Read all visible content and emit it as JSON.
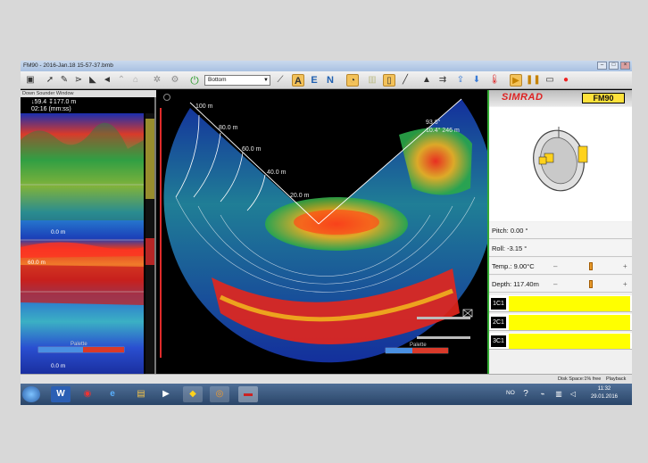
{
  "window": {
    "title": "FM90 - 2016-Jan.18 15-57-37.bmb",
    "min_label": "–",
    "max_label": "□",
    "close_label": "×"
  },
  "toolbar": {
    "bottom_select_value": "Bottom",
    "letter_a": "A",
    "letter_e": "E",
    "letter_n": "N"
  },
  "left_panel": {
    "title": "Down Sounder Window",
    "readout_line1": "↓59.4  ↧177.0 m",
    "readout_line2": "02:16 (mm:ss)",
    "depth_labels": [
      "0.0 m",
      "60.0 m",
      "0.0 m"
    ],
    "palette_label": "Palette"
  },
  "sonar": {
    "range_labels": [
      "100 m",
      "80.0 m",
      "60.0 m",
      "40.0 m",
      "20.0 m"
    ],
    "readout_line1": "93.6°",
    "readout_line2": "10.4°  246 m",
    "palette_label": "Palette"
  },
  "right_panel": {
    "brand": "SIMRAD",
    "model_badge": "FM90",
    "pitch": "Pitch: 0.00 °",
    "roll": "Roll: -3.15 °",
    "temp": "Temp.: 9.00°C",
    "depth": "Depth: 117.40m",
    "channels": [
      "1C1",
      "2C1",
      "3C1"
    ],
    "channel_color": "#ffff00"
  },
  "statusbar": {
    "disk_space": "Disk Space:1% free",
    "mode": "Playback"
  },
  "taskbar": {
    "lang": "NO",
    "time": "11:32",
    "date": "29.01.2016"
  }
}
